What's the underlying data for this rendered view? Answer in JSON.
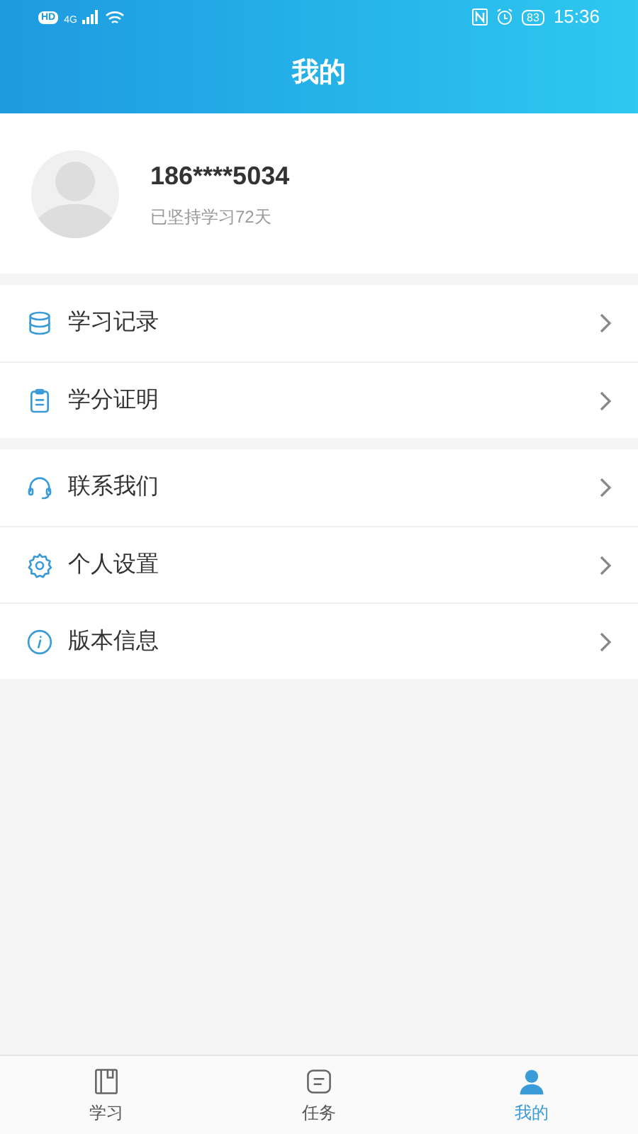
{
  "status_bar": {
    "hd": "HD",
    "network": "4G",
    "battery": "83",
    "time": "15:36"
  },
  "header": {
    "title": "我的"
  },
  "profile": {
    "phone": "186****5034",
    "subtitle": "已坚持学习72天"
  },
  "menu_groups": [
    {
      "items": [
        {
          "kind": "records",
          "label": "学习记录"
        },
        {
          "kind": "certificate",
          "label": "学分证明"
        }
      ]
    },
    {
      "items": [
        {
          "kind": "contact",
          "label": "联系我们"
        },
        {
          "kind": "settings",
          "label": "个人设置"
        },
        {
          "kind": "info",
          "label": "版本信息"
        }
      ]
    }
  ],
  "bottom_nav": [
    {
      "kind": "study",
      "label": "学习",
      "selected": false
    },
    {
      "kind": "tasks",
      "label": "任务",
      "selected": false
    },
    {
      "kind": "mine",
      "label": "我的",
      "selected": true
    }
  ]
}
